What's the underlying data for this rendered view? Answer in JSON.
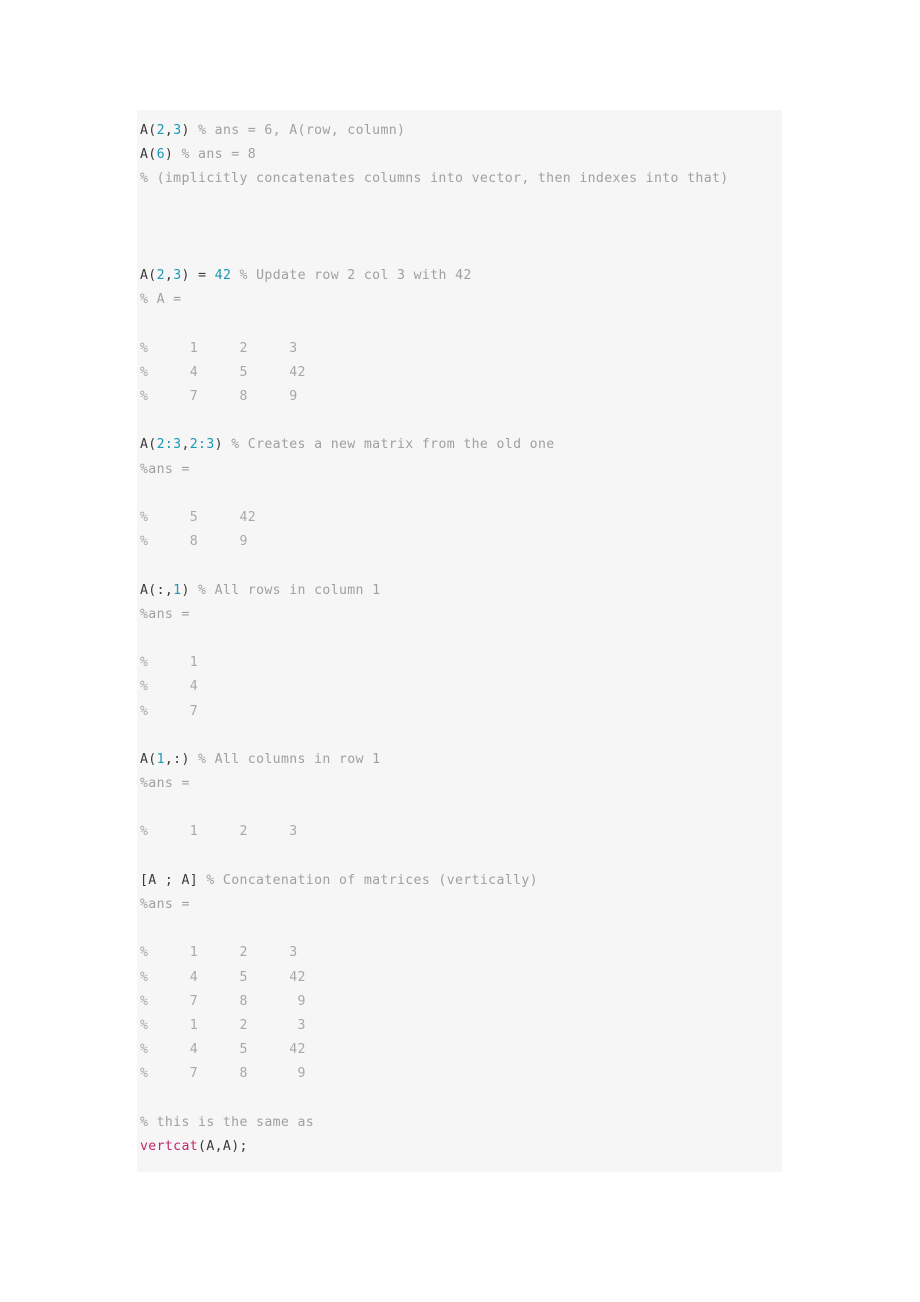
{
  "document": {
    "type": "code-block",
    "language": "matlab",
    "background_color": "#f6f6f6",
    "page_background_color": "#ffffff",
    "colors": {
      "plain": "#3b3b3b",
      "number": "#1899b5",
      "comment": "#a0a0a0",
      "function": "#c2276e",
      "output": "#a8a8a8"
    }
  },
  "code": {
    "lines": [
      {
        "id": "line-1",
        "text": "A(2,3) % ans = 6, A(row, column)",
        "tokens": [
          {
            "t": "A(",
            "k": "plain"
          },
          {
            "t": "2",
            "k": "num"
          },
          {
            "t": ",",
            "k": "plain"
          },
          {
            "t": "3",
            "k": "num"
          },
          {
            "t": ")",
            "k": "plain"
          },
          {
            "t": " % ans = 6, A(row, column)",
            "k": "comment"
          }
        ]
      },
      {
        "id": "line-2",
        "text": "A(6) % ans = 8",
        "tokens": [
          {
            "t": "A(",
            "k": "plain"
          },
          {
            "t": "6",
            "k": "num"
          },
          {
            "t": ")",
            "k": "plain"
          },
          {
            "t": " % ans = 8",
            "k": "comment"
          }
        ]
      },
      {
        "id": "line-3",
        "text": "% (implicitly concatenates columns into vector, then indexes into that)",
        "tokens": [
          {
            "t": "% (implicitly concatenates columns into vector, then indexes into that)",
            "k": "comment"
          }
        ]
      },
      {
        "id": "line-4",
        "text": "",
        "tokens": []
      },
      {
        "id": "line-5",
        "text": "",
        "tokens": []
      },
      {
        "id": "line-6",
        "text": "",
        "tokens": []
      },
      {
        "id": "line-7",
        "text": "A(2,3) = 42 % Update row 2 col 3 with 42",
        "tokens": [
          {
            "t": "A(",
            "k": "plain"
          },
          {
            "t": "2",
            "k": "num"
          },
          {
            "t": ",",
            "k": "plain"
          },
          {
            "t": "3",
            "k": "num"
          },
          {
            "t": ") = ",
            "k": "plain"
          },
          {
            "t": "42",
            "k": "num"
          },
          {
            "t": " % Update row 2 col 3 with 42",
            "k": "comment"
          }
        ]
      },
      {
        "id": "line-8",
        "text": "% A =",
        "tokens": [
          {
            "t": "% A =",
            "k": "comment"
          }
        ]
      },
      {
        "id": "line-9",
        "text": "",
        "tokens": []
      },
      {
        "id": "line-10",
        "text": "%     1     2     3",
        "tokens": [
          {
            "t": "%     1     2     3",
            "k": "output"
          }
        ]
      },
      {
        "id": "line-11",
        "text": "%     4     5     42",
        "tokens": [
          {
            "t": "%     4     5     42",
            "k": "output"
          }
        ]
      },
      {
        "id": "line-12",
        "text": "%     7     8     9",
        "tokens": [
          {
            "t": "%     7     8     9",
            "k": "output"
          }
        ]
      },
      {
        "id": "line-13",
        "text": "",
        "tokens": []
      },
      {
        "id": "line-14",
        "text": "A(2:3,2:3) % Creates a new matrix from the old one",
        "tokens": [
          {
            "t": "A(",
            "k": "plain"
          },
          {
            "t": "2:3",
            "k": "num"
          },
          {
            "t": ",",
            "k": "plain"
          },
          {
            "t": "2:3",
            "k": "num"
          },
          {
            "t": ")",
            "k": "plain"
          },
          {
            "t": " % Creates a new matrix from the old one",
            "k": "comment"
          }
        ]
      },
      {
        "id": "line-15",
        "text": "%ans =",
        "tokens": [
          {
            "t": "%ans =",
            "k": "comment"
          }
        ]
      },
      {
        "id": "line-16",
        "text": "",
        "tokens": []
      },
      {
        "id": "line-17",
        "text": "%     5     42",
        "tokens": [
          {
            "t": "%     5     42",
            "k": "output"
          }
        ]
      },
      {
        "id": "line-18",
        "text": "%     8     9",
        "tokens": [
          {
            "t": "%     8     9",
            "k": "output"
          }
        ]
      },
      {
        "id": "line-19",
        "text": "",
        "tokens": []
      },
      {
        "id": "line-20",
        "text": "A(:,1) % All rows in column 1",
        "tokens": [
          {
            "t": "A(:,",
            "k": "plain"
          },
          {
            "t": "1",
            "k": "num"
          },
          {
            "t": ")",
            "k": "plain"
          },
          {
            "t": " % All rows in column 1",
            "k": "comment"
          }
        ]
      },
      {
        "id": "line-21",
        "text": "%ans =",
        "tokens": [
          {
            "t": "%ans =",
            "k": "comment"
          }
        ]
      },
      {
        "id": "line-22",
        "text": "",
        "tokens": []
      },
      {
        "id": "line-23",
        "text": "%     1",
        "tokens": [
          {
            "t": "%     1",
            "k": "output"
          }
        ]
      },
      {
        "id": "line-24",
        "text": "%     4",
        "tokens": [
          {
            "t": "%     4",
            "k": "output"
          }
        ]
      },
      {
        "id": "line-25",
        "text": "%     7",
        "tokens": [
          {
            "t": "%     7",
            "k": "output"
          }
        ]
      },
      {
        "id": "line-26",
        "text": "",
        "tokens": []
      },
      {
        "id": "line-27",
        "text": "A(1,:) % All columns in row 1",
        "tokens": [
          {
            "t": "A(",
            "k": "plain"
          },
          {
            "t": "1",
            "k": "num"
          },
          {
            "t": ",:)",
            "k": "plain"
          },
          {
            "t": " % All columns in row 1",
            "k": "comment"
          }
        ]
      },
      {
        "id": "line-28",
        "text": "%ans =",
        "tokens": [
          {
            "t": "%ans =",
            "k": "comment"
          }
        ]
      },
      {
        "id": "line-29",
        "text": "",
        "tokens": []
      },
      {
        "id": "line-30",
        "text": "%     1     2     3",
        "tokens": [
          {
            "t": "%     1     2     3",
            "k": "output"
          }
        ]
      },
      {
        "id": "line-31",
        "text": "",
        "tokens": []
      },
      {
        "id": "line-32",
        "text": "[A ; A] % Concatenation of matrices (vertically)",
        "tokens": [
          {
            "t": "[A ; A]",
            "k": "plain"
          },
          {
            "t": " % Concatenation of matrices (vertically)",
            "k": "comment"
          }
        ]
      },
      {
        "id": "line-33",
        "text": "%ans =",
        "tokens": [
          {
            "t": "%ans =",
            "k": "comment"
          }
        ]
      },
      {
        "id": "line-34",
        "text": "",
        "tokens": []
      },
      {
        "id": "line-35",
        "text": "%     1     2     3",
        "tokens": [
          {
            "t": "%     1     2     3",
            "k": "output"
          }
        ]
      },
      {
        "id": "line-36",
        "text": "%     4     5     42",
        "tokens": [
          {
            "t": "%     4     5     42",
            "k": "output"
          }
        ]
      },
      {
        "id": "line-37",
        "text": "%     7     8      9",
        "tokens": [
          {
            "t": "%     7     8      9",
            "k": "output"
          }
        ]
      },
      {
        "id": "line-38",
        "text": "%     1     2      3",
        "tokens": [
          {
            "t": "%     1     2      3",
            "k": "output"
          }
        ]
      },
      {
        "id": "line-39",
        "text": "%     4     5     42",
        "tokens": [
          {
            "t": "%     4     5     42",
            "k": "output"
          }
        ]
      },
      {
        "id": "line-40",
        "text": "%     7     8      9",
        "tokens": [
          {
            "t": "%     7     8      9",
            "k": "output"
          }
        ]
      },
      {
        "id": "line-41",
        "text": "",
        "tokens": []
      },
      {
        "id": "line-42",
        "text": "% this is the same as",
        "tokens": [
          {
            "t": "% this is the same as",
            "k": "comment"
          }
        ]
      },
      {
        "id": "line-43",
        "text": "vertcat(A,A);",
        "tokens": [
          {
            "t": "vertcat",
            "k": "fn"
          },
          {
            "t": "(A,A);",
            "k": "plain"
          }
        ]
      }
    ]
  }
}
